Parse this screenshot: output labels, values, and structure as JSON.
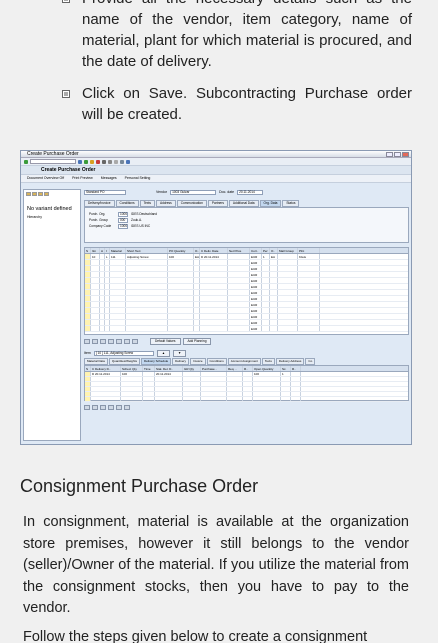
{
  "bullets": [
    "Provide all the necessary details such as the name of the vendor, item category, name of material, plant for which material is procured, and the date of delivery.",
    "Click on Save. Subcontracting Purchase order will be created."
  ],
  "screenshot": {
    "window_title": "Create Purchase Order",
    "app_title": "Create Purchase Order",
    "toolbar_items": [
      "Document Overview Off",
      "Print Preview",
      "Messages",
      "Personal Setting"
    ],
    "left_panel": {
      "variant_text": "No variant defined",
      "hierarchy_label": "Hierarchy"
    },
    "header": {
      "doc_type": "Standard PO",
      "vendor_label": "Vendor",
      "vendor_value": "1003 Gulzar",
      "doc_date_label": "Doc. date",
      "doc_date_value": "20.11.2014"
    },
    "header_tabs": [
      "Delivery/Invoice",
      "Conditions",
      "Texts",
      "Address",
      "Communication",
      "Partners",
      "Additional Data",
      "Org. Data",
      "Status"
    ],
    "org_data": [
      {
        "label": "Purch. Org.",
        "code": "1000",
        "value": "IDES Deutschland"
      },
      {
        "label": "Purch. Group",
        "code": "000",
        "value": "Zuuk.A."
      },
      {
        "label": "Company Code",
        "code": "1000",
        "value": "IDES US INC"
      }
    ],
    "item_columns": [
      "S",
      "Itm",
      "A",
      "I",
      "Material",
      "Short Text",
      "PO Quantity",
      "O..",
      "C Deliv. Date",
      "Net Price",
      "Curr..",
      "Per",
      "O..",
      "Matl Group",
      "Plnt"
    ],
    "item_rows": [
      {
        "itm": "10",
        "i": "L",
        "material": "111",
        "short_text": "Adjusting Screw",
        "qty": "100",
        "unit": "EA",
        "date": "D 20.11.2014",
        "price": "",
        "curr": "EUR",
        "per": "1",
        "ou": "EA",
        "matl": "",
        "plnt": "Kiwis"
      }
    ],
    "empty_rows_curr": "EUR",
    "grid_buttons": [
      "Default Values",
      "Add Planning"
    ],
    "item_selector": {
      "label": "Item",
      "value": "[ 10 ] 111, Adjusting Screw"
    },
    "item_tabs": [
      "Material Data",
      "Quantities/Weights",
      "Delivery Schedule",
      "Delivery",
      "Invoice",
      "Conditions",
      "Account Assignment",
      "Texts",
      "Delivery Address",
      "Co"
    ],
    "schedule_columns": [
      "S",
      "C Delivery D..",
      "Sched. Qty",
      "Time",
      "Stat. Del. D..",
      "GR Qty",
      "Purchase ..",
      "Req. ..",
      "R..",
      "Open Quantity",
      "Sc.",
      "R.."
    ],
    "schedule_rows": [
      {
        "deliv": "D 20.11.2014",
        "qty": "100",
        "stat": "20.11.2014",
        "open": "100",
        "sc": "1"
      }
    ]
  },
  "heading": "Consignment Purchase Order",
  "paragraph": "In consignment, material is available at the organization store premises, however it still belongs to the vendor (seller)/Owner of the material. If you utilize the material from the consignment stocks, then you have to pay to the vendor.",
  "paragraph2": "Follow the steps given below to create a consignment"
}
